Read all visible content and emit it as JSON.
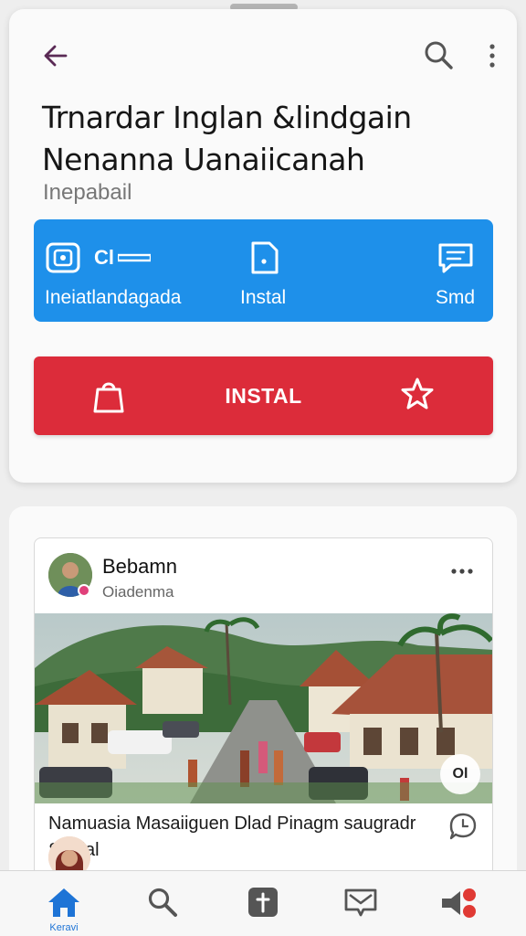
{
  "app": {
    "title_line1": "Trnardar Inglan &lindgain",
    "title_line2": "Nenanna Uanaiicanah",
    "subtitle": "Inepabail"
  },
  "actions": {
    "item1_label": "Ineiatlandagada",
    "item1_extra": "Cl",
    "item2_label": "Instal",
    "item3_label": "Smd"
  },
  "install_button": {
    "label": "INSTAL"
  },
  "post": {
    "author": "Bebamn",
    "handle": "Oiadenma",
    "caption": "Namuasia Masaiiguen Dlad Pinagm saugradr Sealal",
    "image_badge": "Ol"
  },
  "nav": {
    "home_label": "Keravi"
  },
  "colors": {
    "accent_blue": "#1e90ea",
    "install_red": "#dc2c3a",
    "nav_active": "#1e74d6"
  },
  "icons": {
    "back": "arrow-left-icon",
    "search": "search-icon",
    "menu": "kebab-menu-icon",
    "action1": "package-icon",
    "action2": "document-icon",
    "action3": "message-icon",
    "install_left": "shopping-bag-icon",
    "install_right": "star-icon",
    "nav_home": "home-icon",
    "nav_search": "search-icon",
    "nav_add": "add-icon",
    "nav_inbox": "inbox-icon",
    "nav_profile": "profile-icon"
  }
}
